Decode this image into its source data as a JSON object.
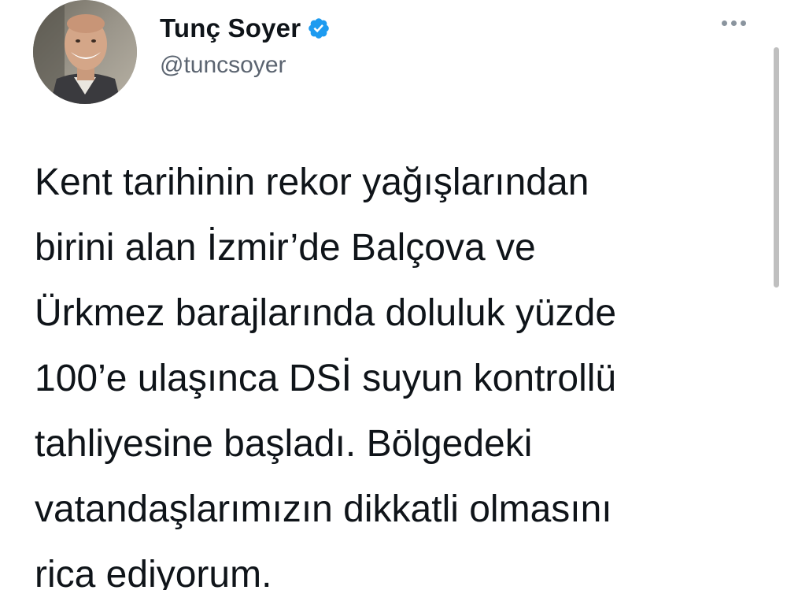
{
  "author": {
    "name": "Tunç Soyer",
    "handle": "@tuncsoyer",
    "verified": true,
    "verified_color": "#1d9bf0"
  },
  "menu": {
    "icon": "more-horizontal-icon"
  },
  "tweet": {
    "lines": [
      "Kent tarihinin rekor yağışlarından",
      "birini alan İzmir’de Balçova ve",
      "Ürkmez barajlarında doluluk yüzde",
      "100’e ulaşınca DSİ suyun kontrollü",
      "tahliyesine başladı. Bölgedeki",
      "vatandaşlarımızın dikkatli olmasını",
      "rica ediyorum."
    ]
  },
  "colors": {
    "text": "#0f1419",
    "secondary": "#5b6470",
    "background": "#ffffff"
  }
}
